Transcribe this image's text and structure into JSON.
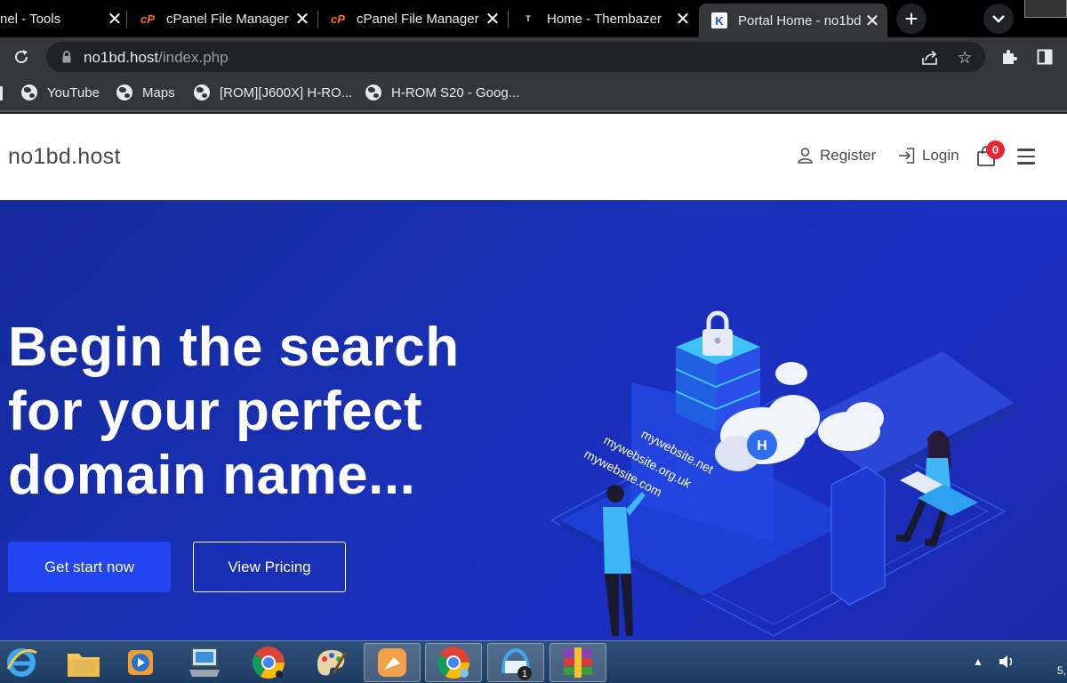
{
  "browser": {
    "tabs": [
      {
        "title": "nel - Tools",
        "active": false
      },
      {
        "title": "cPanel File Manager",
        "active": false
      },
      {
        "title": "cPanel File Manager",
        "active": false
      },
      {
        "title": "Home - Thembazer",
        "active": false
      },
      {
        "title": "Portal Home - no1bd",
        "active": true
      }
    ],
    "new_tab": "+",
    "address": {
      "host": "no1bd.host",
      "path": "/index.php"
    },
    "bookmarks": [
      "YouTube",
      "Maps",
      "[ROM][J600X] H-RO...",
      "H-ROM S20 - Goog..."
    ]
  },
  "site": {
    "brand": "no1bd.host",
    "nav": {
      "register": "Register",
      "login": "Login",
      "cart_count": "0"
    },
    "hero": {
      "title_lines": [
        "Begin the search",
        "for your perfect",
        "domain name..."
      ],
      "primary_button": "Get start now",
      "secondary_button": "View Pricing",
      "illustration_labels": [
        "mywebsite.net",
        "mywebsite.org.uk",
        "mywebsite.com"
      ]
    }
  },
  "taskbar": {
    "apps": [
      "internet-explorer",
      "file-explorer",
      "media-player",
      "remote-desktop",
      "chrome",
      "paint",
      "app-orange",
      "chrome",
      "app-badge",
      "winrar"
    ],
    "badge_count": "1",
    "tray_clock_fragment": "5,"
  },
  "colors": {
    "hero_bg": "#1a2eb8",
    "primary_button": "#2146f2",
    "cart_badge": "#e8262f"
  }
}
